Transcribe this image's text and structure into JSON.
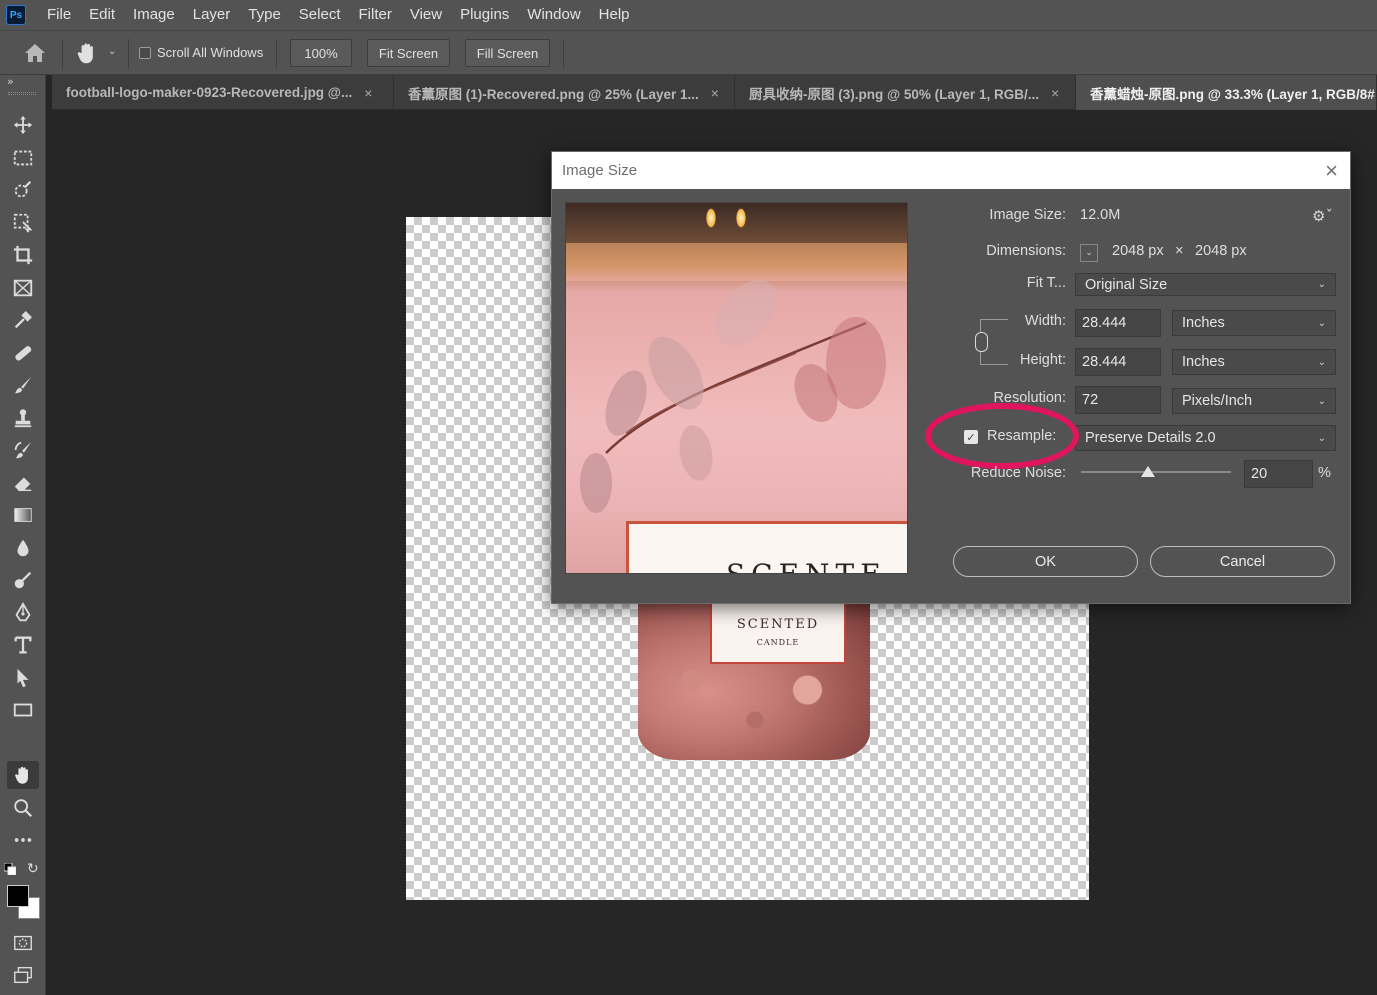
{
  "app": {
    "logo": "Ps"
  },
  "menu": [
    "File",
    "Edit",
    "Image",
    "Layer",
    "Type",
    "Select",
    "Filter",
    "View",
    "Plugins",
    "Window",
    "Help"
  ],
  "options": {
    "scroll_all_windows": "Scroll All Windows",
    "zoom": "100%",
    "fit_screen": "Fit Screen",
    "fill_screen": "Fill Screen"
  },
  "tabs": [
    {
      "label": "football-logo-maker-0923-Recovered.jpg @...",
      "close": "×"
    },
    {
      "label": "香薰原图 (1)-Recovered.png @ 25% (Layer 1...",
      "close": "×"
    },
    {
      "label": "厨具收纳-原图 (3).png @ 50% (Layer 1, RGB/...",
      "close": "×"
    },
    {
      "label": "香薰蜡烛-原图.png @ 33.3% (Layer 1, RGB/8#",
      "close": ""
    }
  ],
  "canvas": {
    "jar_label_line1": "SCENTED",
    "jar_label_line2": "CANDLE"
  },
  "dialog": {
    "title": "Image Size",
    "close": "×",
    "preview_text": "SCENTE",
    "image_size_label": "Image Size:",
    "image_size_value": "12.0M",
    "dimensions_label": "Dimensions:",
    "dimensions_width": "2048 px",
    "dimensions_times": "×",
    "dimensions_height": "2048 px",
    "fit_to_label": "Fit T...",
    "fit_to_value": "Original Size",
    "width_label": "Width:",
    "width_value": "28.444",
    "width_unit": "Inches",
    "height_label": "Height:",
    "height_value": "28.444",
    "height_unit": "Inches",
    "resolution_label": "Resolution:",
    "resolution_value": "72",
    "resolution_unit": "Pixels/Inch",
    "resample_label": "Resample:",
    "resample_checked": true,
    "resample_value": "Preserve Details 2.0",
    "reduce_noise_label": "Reduce Noise:",
    "reduce_noise_value": "20",
    "reduce_noise_percent": 20,
    "reduce_noise_unit": "%",
    "ok": "OK",
    "cancel": "Cancel",
    "highlight_color": "#e0155e"
  }
}
